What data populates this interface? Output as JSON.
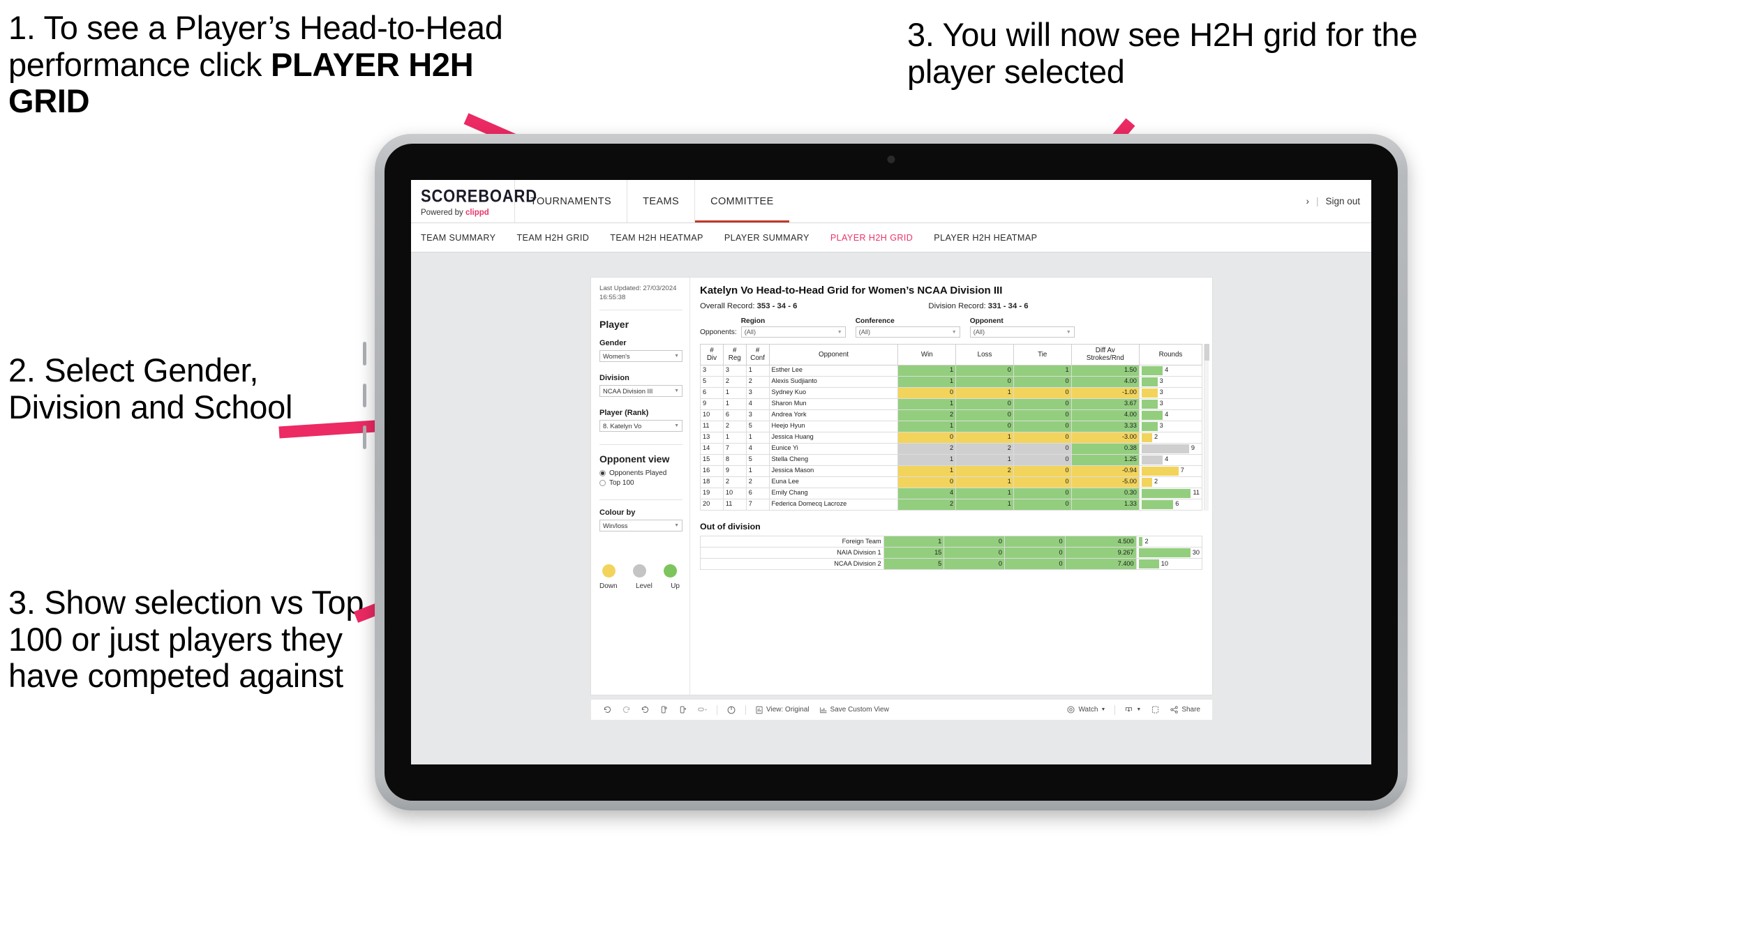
{
  "annotations": {
    "a1_prefix": "1. To see a Player’s Head-to-Head performance click ",
    "a1_bold": "PLAYER H2H GRID",
    "a2": "2. Select Gender, Division and School",
    "a3": "3. Show selection vs Top 100 or just players they have competed against",
    "a4": "3. You will now see H2H grid for the player selected",
    "accent_color": "#ec2a63"
  },
  "app": {
    "brand": {
      "word": "SCOREBOARD",
      "powered_prefix": "Powered by ",
      "powered_brand": "clippd"
    },
    "top_nav": [
      {
        "label": "TOURNAMENTS",
        "active": false
      },
      {
        "label": "TEAMS",
        "active": false
      },
      {
        "label": "COMMITTEE",
        "active": true
      }
    ],
    "top_right": {
      "chevron": "›",
      "separator": "|",
      "sign_out": "Sign out"
    },
    "sub_nav": [
      {
        "label": "TEAM SUMMARY",
        "active": false
      },
      {
        "label": "TEAM H2H GRID",
        "active": false
      },
      {
        "label": "TEAM H2H HEATMAP",
        "active": false
      },
      {
        "label": "PLAYER SUMMARY",
        "active": false
      },
      {
        "label": "PLAYER H2H GRID",
        "active": true
      },
      {
        "label": "PLAYER H2H HEATMAP",
        "active": false
      }
    ],
    "active_link_color": "#e8366a"
  },
  "panel": {
    "last_updated": "Last Updated: 27/03/2024 16:55:38",
    "section_player": "Player",
    "filters": [
      {
        "label": "Gender",
        "value": "Women's"
      },
      {
        "label": "Division",
        "value": "NCAA Division III"
      },
      {
        "label": "Player (Rank)",
        "value": "8. Katelyn Vo"
      }
    ],
    "opponent_view": {
      "title": "Opponent view",
      "options": [
        {
          "label": "Opponents Played",
          "selected": true
        },
        {
          "label": "Top 100",
          "selected": false
        }
      ]
    },
    "colour_by": {
      "label": "Colour by",
      "value": "Win/loss"
    },
    "legend": [
      {
        "label": "Down",
        "color": "#f2d45c"
      },
      {
        "label": "Level",
        "color": "#c4c4c4"
      },
      {
        "label": "Up",
        "color": "#7dc45c"
      }
    ]
  },
  "main": {
    "title": "Katelyn Vo Head-to-Head Grid for Women’s NCAA Division III",
    "overall_record_label": "Overall Record: ",
    "overall_record_value": "353 - 34 - 6",
    "division_record_label": "Division Record: ",
    "division_record_value": "331 - 34 - 6",
    "opponents_label": "Opponents:",
    "opponent_filters": [
      {
        "label": "Region",
        "value": "(All)"
      },
      {
        "label": "Conference",
        "value": "(All)"
      },
      {
        "label": "Opponent",
        "value": "(All)"
      }
    ],
    "out_of_division_title": "Out of division"
  },
  "chart_data": {
    "type": "table",
    "title": "Katelyn Vo Head-to-Head Grid for Women’s NCAA Division III",
    "columns": [
      "# Div",
      "# Reg",
      "# Conf",
      "Opponent",
      "Win",
      "Loss",
      "Tie",
      "Diff Av Strokes/Rnd",
      "Rounds"
    ],
    "column_header_lines": [
      [
        "#",
        "Div"
      ],
      [
        "#",
        "Reg"
      ],
      [
        "#",
        "Conf"
      ],
      [
        "Opponent"
      ],
      [
        "Win"
      ],
      [
        "Loss"
      ],
      [
        "Tie"
      ],
      [
        "Diff Av",
        "Strokes/Rnd"
      ],
      [
        "Rounds"
      ]
    ],
    "rounds_max": 11,
    "colors": {
      "up": "#93ce7e",
      "down": "#f2d45c",
      "level": "#cfcfcf"
    },
    "rows": [
      {
        "div": "3",
        "reg": "3",
        "conf": "1",
        "opponent": "Esther Lee",
        "win": "1",
        "loss": "0",
        "tie": "1",
        "diff": "1.50",
        "rounds": 4,
        "state": "up"
      },
      {
        "div": "5",
        "reg": "2",
        "conf": "2",
        "opponent": "Alexis Sudjianto",
        "win": "1",
        "loss": "0",
        "tie": "0",
        "diff": "4.00",
        "rounds": 3,
        "state": "up"
      },
      {
        "div": "6",
        "reg": "1",
        "conf": "3",
        "opponent": "Sydney Kuo",
        "win": "0",
        "loss": "1",
        "tie": "0",
        "diff": "-1.00",
        "rounds": 3,
        "state": "down"
      },
      {
        "div": "9",
        "reg": "1",
        "conf": "4",
        "opponent": "Sharon Mun",
        "win": "1",
        "loss": "0",
        "tie": "0",
        "diff": "3.67",
        "rounds": 3,
        "state": "up"
      },
      {
        "div": "10",
        "reg": "6",
        "conf": "3",
        "opponent": "Andrea York",
        "win": "2",
        "loss": "0",
        "tie": "0",
        "diff": "4.00",
        "rounds": 4,
        "state": "up"
      },
      {
        "div": "11",
        "reg": "2",
        "conf": "5",
        "opponent": "Heejo Hyun",
        "win": "1",
        "loss": "0",
        "tie": "0",
        "diff": "3.33",
        "rounds": 3,
        "state": "up"
      },
      {
        "div": "13",
        "reg": "1",
        "conf": "1",
        "opponent": "Jessica Huang",
        "win": "0",
        "loss": "1",
        "tie": "0",
        "diff": "-3.00",
        "rounds": 2,
        "state": "down"
      },
      {
        "div": "14",
        "reg": "7",
        "conf": "4",
        "opponent": "Eunice Yi",
        "win": "2",
        "loss": "2",
        "tie": "0",
        "diff": "0.38",
        "rounds": 9,
        "state": "level",
        "diff_state": "up"
      },
      {
        "div": "15",
        "reg": "8",
        "conf": "5",
        "opponent": "Stella Cheng",
        "win": "1",
        "loss": "1",
        "tie": "0",
        "diff": "1.25",
        "rounds": 4,
        "state": "level",
        "diff_state": "up"
      },
      {
        "div": "16",
        "reg": "9",
        "conf": "1",
        "opponent": "Jessica Mason",
        "win": "1",
        "loss": "2",
        "tie": "0",
        "diff": "-0.94",
        "rounds": 7,
        "state": "down"
      },
      {
        "div": "18",
        "reg": "2",
        "conf": "2",
        "opponent": "Euna Lee",
        "win": "0",
        "loss": "1",
        "tie": "0",
        "diff": "-5.00",
        "rounds": 2,
        "state": "down"
      },
      {
        "div": "19",
        "reg": "10",
        "conf": "6",
        "opponent": "Emily Chang",
        "win": "4",
        "loss": "1",
        "tie": "0",
        "diff": "0.30",
        "rounds": 11,
        "state": "up"
      },
      {
        "div": "20",
        "reg": "11",
        "conf": "7",
        "opponent": "Federica Domecq Lacroze",
        "win": "2",
        "loss": "1",
        "tie": "0",
        "diff": "1.33",
        "rounds": 6,
        "state": "up"
      }
    ],
    "out_of_division": {
      "rounds_max": 30,
      "rows": [
        {
          "name": "Foreign Team",
          "win": "1",
          "loss": "0",
          "tie": "0",
          "diff": "4.500",
          "rounds": 2,
          "state": "up"
        },
        {
          "name": "NAIA Division 1",
          "win": "15",
          "loss": "0",
          "tie": "0",
          "diff": "9.267",
          "rounds": 30,
          "state": "up"
        },
        {
          "name": "NCAA Division 2",
          "win": "5",
          "loss": "0",
          "tie": "0",
          "diff": "7.400",
          "rounds": 10,
          "state": "up"
        }
      ]
    }
  },
  "toolbar": {
    "undo": "undo-icon",
    "redo": "redo-icon",
    "revert": "revert-icon",
    "refresh": "refresh-data-icon",
    "pause": "pause-updates-icon",
    "view_original": "View: Original",
    "save_custom_view": "Save Custom View",
    "watch": "Watch",
    "share": "Share"
  }
}
